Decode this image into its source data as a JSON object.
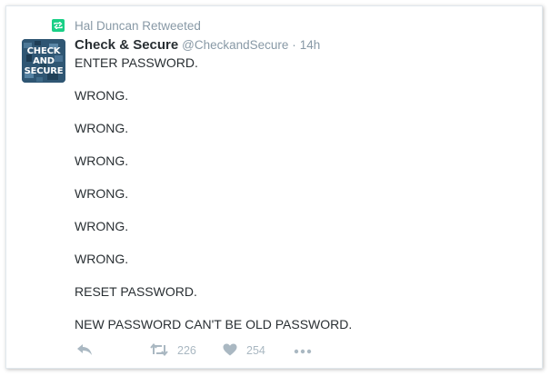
{
  "retweet_context": {
    "icon": "retweet-icon",
    "text": "Hal Duncan Retweeted",
    "badge_color": "#19cf86"
  },
  "tweet": {
    "avatar": {
      "line1": "CHECK",
      "line2": "AND",
      "line3": "SECURE"
    },
    "fullname": "Check & Secure",
    "username": "@CheckandSecure",
    "separator": "·",
    "time": "14h",
    "lines": [
      "ENTER PASSWORD.",
      "WRONG.",
      "WRONG.",
      "WRONG.",
      "WRONG.",
      "WRONG.",
      "WRONG.",
      "RESET PASSWORD.",
      "NEW PASSWORD CAN'T BE OLD PASSWORD."
    ],
    "actions": {
      "reply_icon": "reply-icon",
      "retweet_icon": "retweet-icon",
      "retweet_count": "226",
      "like_icon": "heart-icon",
      "like_count": "254",
      "more_icon": "more-icon"
    }
  },
  "colors": {
    "text": "#292f33",
    "muted": "#8899a6",
    "action": "#aab8c2"
  }
}
